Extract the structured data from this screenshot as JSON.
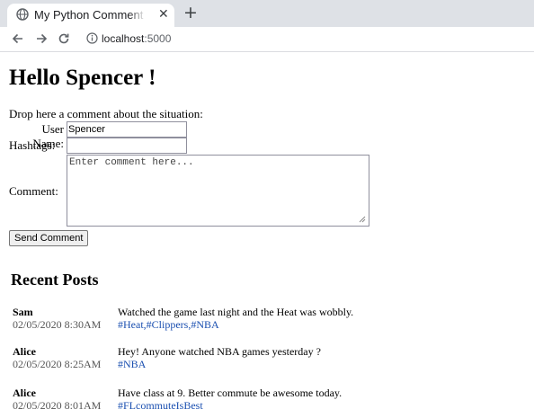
{
  "browser": {
    "tab_title": "My Python Comment Page",
    "url_host": "localhost",
    "url_port": ":5000"
  },
  "page": {
    "heading": "Hello Spencer !",
    "intro": "Drop here a comment about the situation:",
    "form": {
      "username_label": "User Name:",
      "username_value": "Spencer",
      "hashtags_label": "Hashtags:",
      "hashtags_value": "",
      "comment_label": "Comment:",
      "comment_placeholder": "Enter comment here...",
      "send_label": "Send Comment"
    },
    "recent_title": "Recent Posts",
    "posts": [
      {
        "author": "Sam",
        "timestamp": "02/05/2020 8:30AM",
        "text": "Watched the game last night and the Heat was wobbly.",
        "hashtags": "#Heat,#Clippers,#NBA"
      },
      {
        "author": "Alice",
        "timestamp": "02/05/2020 8:25AM",
        "text": "Hey! Anyone watched NBA games yesterday ?",
        "hashtags": "#NBA"
      },
      {
        "author": "Alice",
        "timestamp": "02/05/2020 8:01AM",
        "text": "Have class at 9. Better commute be awesome today.",
        "hashtags": "#FLcommuteIsBest"
      }
    ]
  }
}
